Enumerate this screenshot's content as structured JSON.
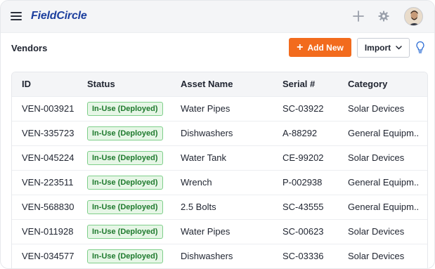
{
  "app": {
    "logo": "FieldCircle"
  },
  "header": {
    "title": "Vendors",
    "add_label": "Add New",
    "import_label": "Import"
  },
  "icons": {
    "menu": "hamburger-icon",
    "plus": "plus-icon",
    "settings": "gear-icon",
    "avatar": "user-avatar",
    "tips": "lightbulb-icon"
  },
  "colors": {
    "brand": "#1c3f9e",
    "accent": "#f26b1d",
    "status_bg": "#e6f6e6",
    "status_border": "#7fcf8a",
    "status_text": "#1f7a2e"
  },
  "table": {
    "columns": [
      "ID",
      "Status",
      "Asset Name",
      "Serial #",
      "Category"
    ],
    "rows": [
      {
        "id": "VEN-003921",
        "status": "In-Use (Deployed)",
        "asset": "Water Pipes",
        "serial": "SC-03922",
        "category": "Solar Devices"
      },
      {
        "id": "VEN-335723",
        "status": "In-Use (Deployed)",
        "asset": "Dishwashers",
        "serial": "A-88292",
        "category": "General Equipm.."
      },
      {
        "id": "VEN-045224",
        "status": "In-Use (Deployed)",
        "asset": "Water Tank",
        "serial": "CE-99202",
        "category": "Solar Devices"
      },
      {
        "id": "VEN-223511",
        "status": "In-Use (Deployed)",
        "asset": "Wrench",
        "serial": "P-002938",
        "category": "General Equipm.."
      },
      {
        "id": "VEN-568830",
        "status": "In-Use (Deployed)",
        "asset": "2.5 Bolts",
        "serial": "SC-43555",
        "category": "General Equipm.."
      },
      {
        "id": "VEN-011928",
        "status": "In-Use (Deployed)",
        "asset": "Water Pipes",
        "serial": "SC-00623",
        "category": "Solar Devices"
      },
      {
        "id": "VEN-034577",
        "status": "In-Use (Deployed)",
        "asset": "Dishwashers",
        "serial": "SC-03336",
        "category": "Solar Devices"
      }
    ]
  }
}
